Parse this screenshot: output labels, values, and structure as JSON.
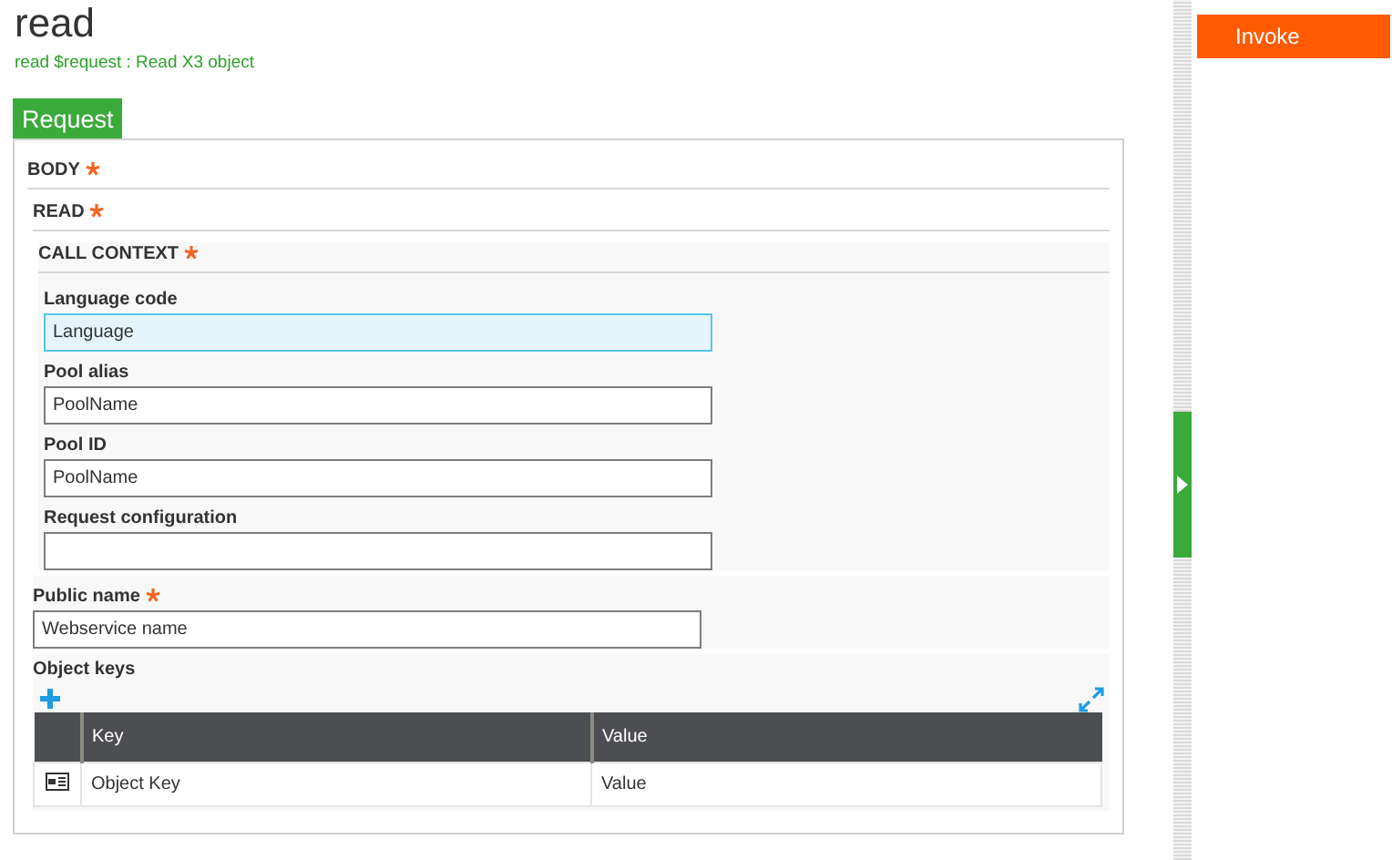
{
  "header": {
    "title": "read",
    "subtitle": "read $request : Read X3 object"
  },
  "tabs": [
    {
      "label": "Request",
      "selected": true
    }
  ],
  "body": {
    "label": "BODY",
    "required": true,
    "read": {
      "label": "READ",
      "required": true,
      "call_context": {
        "label": "CALL CONTEXT",
        "required": true,
        "fields": [
          {
            "label": "Language code",
            "required": false,
            "value": "Language",
            "focused": true
          },
          {
            "label": "Pool alias",
            "required": false,
            "value": "PoolName",
            "focused": false
          },
          {
            "label": "Pool ID",
            "required": false,
            "value": "PoolName",
            "focused": false
          },
          {
            "label": "Request configuration",
            "required": false,
            "focused": false
          }
        ]
      },
      "fields": [
        {
          "label": "Public name",
          "required": true,
          "value": "Webservice name",
          "focused": false
        }
      ],
      "object_keys": {
        "label": "Object keys",
        "columns": [
          "Key",
          "Value"
        ],
        "rows": [
          {
            "key": "Object Key",
            "value": "Value"
          }
        ]
      }
    }
  },
  "invoke_button": "Invoke"
}
